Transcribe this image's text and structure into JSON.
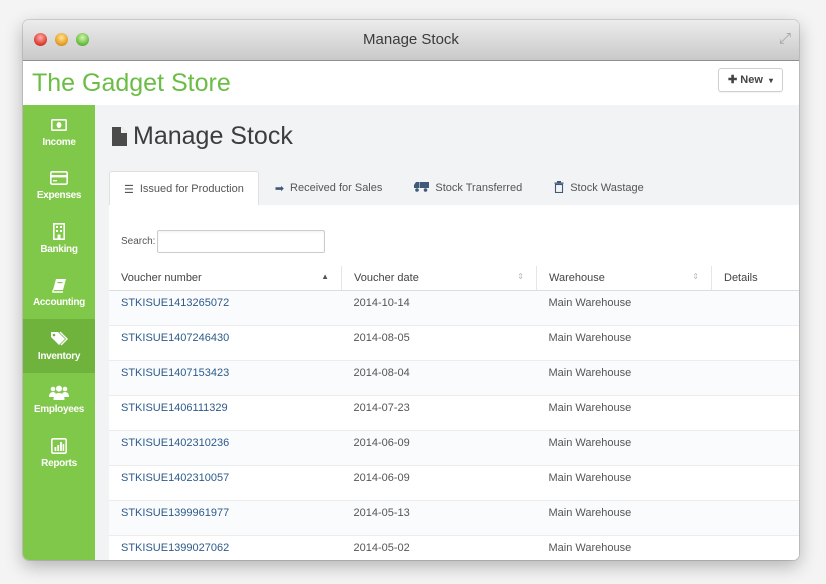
{
  "window": {
    "title": "Manage Stock"
  },
  "header": {
    "brand": "The Gadget Store",
    "new_button": {
      "icon": "plus",
      "label": "New",
      "caret": "▾"
    }
  },
  "sidebar": {
    "items": [
      {
        "label": "Income",
        "icon": "money-icon",
        "active": false
      },
      {
        "label": "Expenses",
        "icon": "credit-card-icon",
        "active": false
      },
      {
        "label": "Banking",
        "icon": "building-icon",
        "active": false
      },
      {
        "label": "Accounting",
        "icon": "book-icon",
        "active": false
      },
      {
        "label": "Inventory",
        "icon": "tags-icon",
        "active": true
      },
      {
        "label": "Employees",
        "icon": "users-icon",
        "active": false
      },
      {
        "label": "Reports",
        "icon": "bar-chart-icon",
        "active": false
      }
    ]
  },
  "main": {
    "page_title": "Manage Stock",
    "tabs": [
      {
        "label": "Issued for Production",
        "icon": "list-icon",
        "active": true
      },
      {
        "label": "Received for Sales",
        "icon": "sign-in-icon",
        "active": false
      },
      {
        "label": "Stock Transferred",
        "icon": "truck-icon",
        "active": false
      },
      {
        "label": "Stock Wastage",
        "icon": "trash-icon",
        "active": false
      }
    ],
    "search": {
      "label": "Search:",
      "value": "",
      "placeholder": ""
    },
    "table": {
      "columns": [
        "Voucher number",
        "Voucher date",
        "Warehouse",
        "Details"
      ],
      "rows": [
        {
          "voucher_number": "STKISUE1413265072",
          "voucher_date": "2014-10-14",
          "warehouse": "Main Warehouse"
        },
        {
          "voucher_number": "STKISUE1407246430",
          "voucher_date": "2014-08-05",
          "warehouse": "Main Warehouse"
        },
        {
          "voucher_number": "STKISUE1407153423",
          "voucher_date": "2014-08-04",
          "warehouse": "Main Warehouse"
        },
        {
          "voucher_number": "STKISUE1406111329",
          "voucher_date": "2014-07-23",
          "warehouse": "Main Warehouse"
        },
        {
          "voucher_number": "STKISUE1402310236",
          "voucher_date": "2014-06-09",
          "warehouse": "Main Warehouse"
        },
        {
          "voucher_number": "STKISUE1402310057",
          "voucher_date": "2014-06-09",
          "warehouse": "Main Warehouse"
        },
        {
          "voucher_number": "STKISUE1399961977",
          "voucher_date": "2014-05-13",
          "warehouse": "Main Warehouse"
        },
        {
          "voucher_number": "STKISUE1399027062",
          "voucher_date": "2014-05-02",
          "warehouse": "Main Warehouse"
        }
      ]
    }
  }
}
